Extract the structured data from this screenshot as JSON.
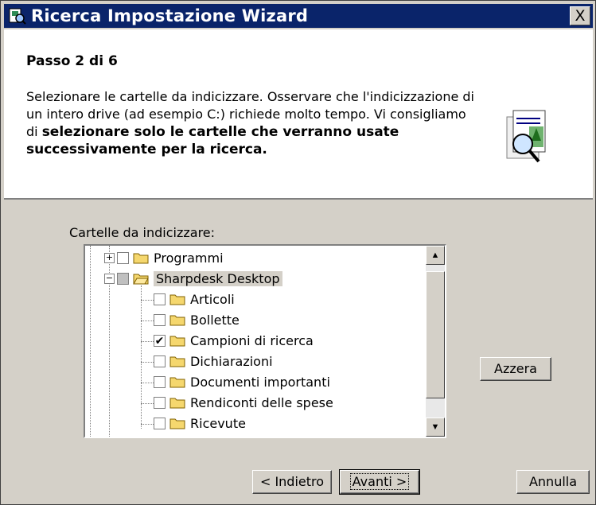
{
  "window": {
    "title": "Ricerca Impostazione Wizard",
    "close_label": "X"
  },
  "header": {
    "step": "Passo 2 di 6",
    "desc_normal": "Selezionare le cartelle da indicizzare. Osservare che l'indicizzazione di un intero drive (ad esempio C:) richiede molto tempo. Vi consigliamo di ",
    "desc_bold": "selezionare solo le cartelle che verranno usate successivamente per la ricerca."
  },
  "tree": {
    "label": "Cartelle da indicizzare:",
    "items": [
      {
        "label": "Programmi",
        "checked": false
      },
      {
        "label": "Sharpdesk Desktop",
        "checked": false,
        "partial": true
      },
      {
        "label": "Articoli",
        "checked": false
      },
      {
        "label": "Bollette",
        "checked": false
      },
      {
        "label": "Campioni di ricerca",
        "checked": true
      },
      {
        "label": "Dichiarazioni",
        "checked": false
      },
      {
        "label": "Documenti importanti",
        "checked": false
      },
      {
        "label": "Rendiconti delle spese",
        "checked": false
      },
      {
        "label": "Ricevute",
        "checked": false
      }
    ]
  },
  "buttons": {
    "reset": "Azzera",
    "back": "< Indietro",
    "next": "Avanti >",
    "cancel": "Annulla"
  },
  "colors": {
    "titlebar": "#0a246a",
    "face": "#d4d0c8"
  }
}
